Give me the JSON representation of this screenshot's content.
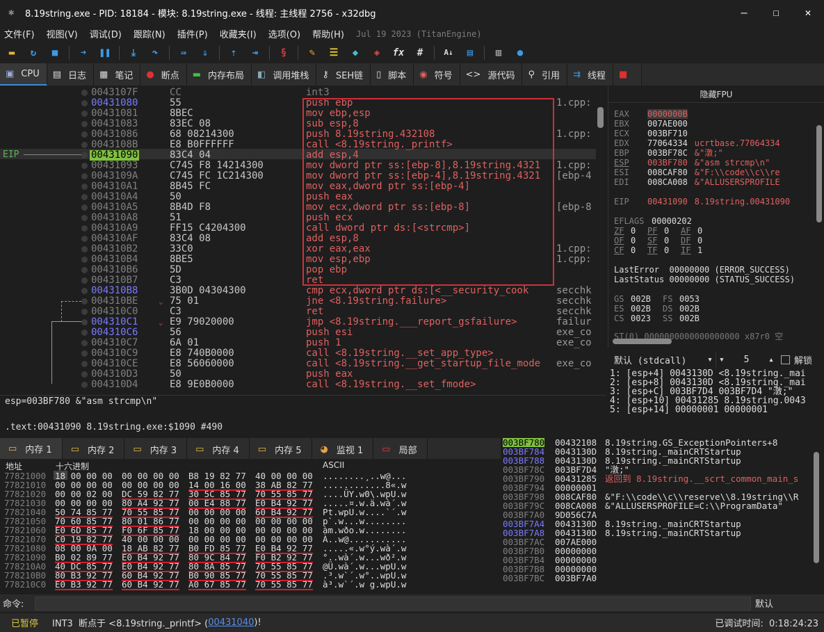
{
  "window": {
    "title": "8.19string.exe - PID: 18184 - 模块: 8.19string.exe - 线程: 主线程 2756 - x32dbg",
    "minimize": "—",
    "maximize": "☐",
    "close": "✕"
  },
  "menu": {
    "items": [
      "文件(F)",
      "视图(V)",
      "调试(D)",
      "跟踪(N)",
      "插件(P)",
      "收藏夹(I)",
      "选项(O)",
      "帮助(H)"
    ],
    "date": "Jul 19 2023 (TitanEngine)"
  },
  "toolbar": {
    "icons": [
      "open-icon",
      "restart-icon",
      "stop-icon",
      "run-icon",
      "pause-icon",
      "step-into-icon",
      "step-over-icon",
      "trace-into-icon",
      "trace-over-icon",
      "execute-till-return-icon",
      "run-to-user-code-icon",
      "scylla-icon",
      "patch-icon",
      "comment-icon",
      "label-icon",
      "bookmark-icon",
      "function-icon",
      "hash-icon",
      "font-icon",
      "calculator-icon",
      "memo-icon",
      "globe-icon"
    ]
  },
  "tabs_top": [
    {
      "label": "CPU",
      "icon": "cpu-icon"
    },
    {
      "label": "日志",
      "icon": "log-icon"
    },
    {
      "label": "笔记",
      "icon": "notes-icon"
    },
    {
      "label": "断点",
      "icon": "breakpoint-icon"
    },
    {
      "label": "内存布局",
      "icon": "memory-map-icon"
    },
    {
      "label": "调用堆栈",
      "icon": "callstack-icon"
    },
    {
      "label": "SEH链",
      "icon": "seh-icon"
    },
    {
      "label": "脚本",
      "icon": "script-icon"
    },
    {
      "label": "符号",
      "icon": "symbol-icon"
    },
    {
      "label": "源代码",
      "icon": "source-icon"
    },
    {
      "label": "引用",
      "icon": "reference-icon"
    },
    {
      "label": "线程",
      "icon": "thread-icon"
    }
  ],
  "disasm": {
    "eip_label": "EIP",
    "rows": [
      {
        "addr": "0043107F",
        "bytes": "CC",
        "asm": "int3",
        "cmt": "",
        "dim": true
      },
      {
        "addr": "00431080",
        "bytes": "55",
        "asm": "push ebp",
        "cmt": "1.cpp:"
      },
      {
        "addr": "00431081",
        "bytes": "8BEC",
        "asm": "mov ebp,esp",
        "cmt": ""
      },
      {
        "addr": "00431083",
        "bytes": "83EC 08",
        "asm": "sub esp,8",
        "cmt": ""
      },
      {
        "addr": "00431086",
        "bytes": "68 08214300",
        "asm": "push 8.19string.432108",
        "cmt": "1.cpp:"
      },
      {
        "addr": "0043108B",
        "bytes": "E8 B0FFFFFF",
        "asm": "call <8.19string._printf>",
        "cmt": ""
      },
      {
        "addr": "00431090",
        "bytes": "83C4 04",
        "asm": "add esp,4",
        "cmt": ""
      },
      {
        "addr": "00431093",
        "bytes": "C745 F8 14214300",
        "asm": "mov dword ptr ss:[ebp-8],8.19string.4321",
        "cmt": "1.cpp:"
      },
      {
        "addr": "0043109A",
        "bytes": "C745 FC 1C214300",
        "asm": "mov dword ptr ss:[ebp-4],8.19string.4321",
        "cmt": "[ebp-4"
      },
      {
        "addr": "004310A1",
        "bytes": "8B45 FC",
        "asm": "mov eax,dword ptr ss:[ebp-4]",
        "cmt": ""
      },
      {
        "addr": "004310A4",
        "bytes": "50",
        "asm": "push eax",
        "cmt": ""
      },
      {
        "addr": "004310A5",
        "bytes": "8B4D F8",
        "asm": "mov ecx,dword ptr ss:[ebp-8]",
        "cmt": "[ebp-8"
      },
      {
        "addr": "004310A8",
        "bytes": "51",
        "asm": "push ecx",
        "cmt": ""
      },
      {
        "addr": "004310A9",
        "bytes": "FF15 C4204300",
        "asm": "call dword ptr ds:[<strcmp>]",
        "cmt": ""
      },
      {
        "addr": "004310AF",
        "bytes": "83C4 08",
        "asm": "add esp,8",
        "cmt": ""
      },
      {
        "addr": "004310B2",
        "bytes": "33C0",
        "asm": "xor eax,eax",
        "cmt": "1.cpp:"
      },
      {
        "addr": "004310B4",
        "bytes": "8BE5",
        "asm": "mov esp,ebp",
        "cmt": "1.cpp:"
      },
      {
        "addr": "004310B6",
        "bytes": "5D",
        "asm": "pop ebp",
        "cmt": ""
      },
      {
        "addr": "004310B7",
        "bytes": "C3",
        "asm": "ret",
        "cmt": ""
      },
      {
        "addr": "004310B8",
        "bytes": "3B0D 04304300",
        "asm": "cmp ecx,dword ptr ds:[<__security_cook",
        "cmt": "secchk"
      },
      {
        "addr": "004310BE",
        "bytes": "75 01",
        "asm": "jne <8.19string.failure>",
        "cmt": "secchk"
      },
      {
        "addr": "004310C0",
        "bytes": "C3",
        "asm": "ret",
        "cmt": "secchk"
      },
      {
        "addr": "004310C1",
        "bytes": "E9 79020000",
        "asm": "jmp <8.19string.___report_gsfailure>",
        "cmt": "failur"
      },
      {
        "addr": "004310C6",
        "bytes": "56",
        "asm": "push esi",
        "cmt": "exe_co"
      },
      {
        "addr": "004310C7",
        "bytes": "6A 01",
        "asm": "push 1",
        "cmt": "exe_co"
      },
      {
        "addr": "004310C9",
        "bytes": "E8 740B0000",
        "asm": "call <8.19string.__set_app_type>",
        "cmt": ""
      },
      {
        "addr": "004310CE",
        "bytes": "E8 56060000",
        "asm": "call <8.19string.__get_startup_file_mode",
        "cmt": "exe_co"
      },
      {
        "addr": "004310D3",
        "bytes": "50",
        "asm": "push eax",
        "cmt": ""
      },
      {
        "addr": "004310D4",
        "bytes": "E8 9E0B0000",
        "asm": "call <8.19string.__set_fmode>",
        "cmt": ""
      }
    ]
  },
  "info_line1": "esp=003BF780 &\"asm strcmp\\n\"",
  "info_line2": ".text:00431090 8.19string.exe:$1090 #490",
  "registers": {
    "header": "隐藏FPU",
    "rows": [
      {
        "name": "EAX",
        "value": "0000000B",
        "sym": ""
      },
      {
        "name": "EBX",
        "value": "007AE000",
        "sym": ""
      },
      {
        "name": "ECX",
        "value": "003BF710",
        "sym": ""
      },
      {
        "name": "EDX",
        "value": "77064334",
        "sym": "ucrtbase.77064334"
      },
      {
        "name": "EBP",
        "value": "003BF78C",
        "sym": "&\"潡;\""
      },
      {
        "name": "ESP",
        "value": "003BF780",
        "sym": "&\"asm strcmp\\n\""
      },
      {
        "name": "ESI",
        "value": "008CAF80",
        "sym": "&\"F:\\\\code\\\\c\\\\re"
      },
      {
        "name": "EDI",
        "value": "008CA008",
        "sym": "&\"ALLUSERSPROFILE"
      },
      {
        "name": "EIP",
        "value": "00431090",
        "sym": "8.19string.00431090"
      }
    ],
    "eflags_label": "EFLAGS",
    "eflags_value": "00000202",
    "flags": [
      [
        {
          "n": "ZF",
          "v": "0"
        },
        {
          "n": "PF",
          "v": "0"
        },
        {
          "n": "AF",
          "v": "0"
        }
      ],
      [
        {
          "n": "OF",
          "v": "0"
        },
        {
          "n": "SF",
          "v": "0"
        },
        {
          "n": "DF",
          "v": "0"
        }
      ],
      [
        {
          "n": "CF",
          "v": "0"
        },
        {
          "n": "TF",
          "v": "0"
        },
        {
          "n": "IF",
          "v": "1"
        }
      ]
    ],
    "lasterror": "LastError  00000000 (ERROR_SUCCESS)",
    "laststatus": "LastStatus 00000000 (STATUS_SUCCESS)",
    "segs": [
      [
        {
          "n": "GS",
          "v": "002B"
        },
        {
          "n": "FS",
          "v": "0053"
        }
      ],
      [
        {
          "n": "ES",
          "v": "002B"
        },
        {
          "n": "DS",
          "v": "002B"
        }
      ],
      [
        {
          "n": "CS",
          "v": "0023"
        },
        {
          "n": "SS",
          "v": "002B"
        }
      ]
    ],
    "st0": "ST(0) 0000000000000000000 x87r0 空"
  },
  "callconv": {
    "selected": "默认 (stdcall)",
    "count": "5",
    "unlock_label": "解锁"
  },
  "args": [
    "1: [esp+4] 0043130D <8.19string._mai",
    "2: [esp+8] 0043130D <8.19string._mai",
    "3: [esp+C] 003BF7D4 003BF7D4 \"潡;\"",
    "4: [esp+10] 00431285 8.19string.0043",
    "5: [esp+14] 00000001 00000001"
  ],
  "tabs_bottom": [
    {
      "label": "内存 1",
      "icon": "memory-icon"
    },
    {
      "label": "内存 2",
      "icon": "memory-icon"
    },
    {
      "label": "内存 3",
      "icon": "memory-icon"
    },
    {
      "label": "内存 4",
      "icon": "memory-icon"
    },
    {
      "label": "内存 5",
      "icon": "memory-icon"
    },
    {
      "label": "监视 1",
      "icon": "watch-icon"
    },
    {
      "label": "局部",
      "icon": "locals-icon"
    }
  ],
  "dump": {
    "col_addr": "地址",
    "col_hex": "十六进制",
    "col_ascii": "ASCII",
    "rows": [
      {
        "addr": "77821000",
        "h": [
          "18 00 00 00",
          "00 00 00 00",
          "B8 19 82 77",
          "40 00 00 00"
        ],
        "a": "........¸..w@..."
      },
      {
        "addr": "77821010",
        "h": [
          "00 00 00 00",
          "00 00 00 00",
          "14 00 16 00",
          "38 AB 82 77"
        ],
        "a": "............8«.w"
      },
      {
        "addr": "77821020",
        "h": [
          "00 00 02 00",
          "DC 59 82 77",
          "30 5C 85 77",
          "70 55 85 77"
        ],
        "a": "....ÜY.w0\\.wpU.w"
      },
      {
        "addr": "77821030",
        "h": [
          "00 00 00 00",
          "80 A4 92 77",
          "00 E4 88 77",
          "E0 B4 92 77"
        ],
        "a": ".....¤.w.ä.wà´.w"
      },
      {
        "addr": "77821040",
        "h": [
          "50 74 85 77",
          "70 55 85 77",
          "00 00 00 00",
          "60 B4 92 77"
        ],
        "a": "Pt.wpU.w....`´.w"
      },
      {
        "addr": "77821050",
        "h": [
          "70 60 85 77",
          "80 01 86 77",
          "00 00 00 00",
          "00 00 00 00"
        ],
        "a": "p`.w...w........"
      },
      {
        "addr": "77821060",
        "h": [
          "E0 6D 85 77",
          "F0 6F 85 77",
          "18 00 00 00",
          "00 00 00 00"
        ],
        "a": "àm.wðo.w........"
      },
      {
        "addr": "77821070",
        "h": [
          "C0 19 82 77",
          "40 00 00 00",
          "00 00 00 00",
          "00 00 00 00"
        ],
        "a": "À..w@..........."
      },
      {
        "addr": "77821080",
        "h": [
          "08 00 0A 00",
          "18 AB 82 77",
          "B0 FD 85 77",
          "E0 B4 92 77"
        ],
        "a": ".....«.w°ý.wà´.w"
      },
      {
        "addr": "77821090",
        "h": [
          "B0 02 89 77",
          "E0 B4 92 77",
          "80 9C 84 77",
          "F0 B2 92 77"
        ],
        "a": "°..wà´.w...wð².w"
      },
      {
        "addr": "778210A0",
        "h": [
          "40 DC 85 77",
          "E0 B4 92 77",
          "80 8A 85 77",
          "70 55 85 77"
        ],
        "a": "@Ü.wà´.w...wpU.w"
      },
      {
        "addr": "778210B0",
        "h": [
          "80 B3 92 77",
          "60 B4 92 77",
          "B0 90 85 77",
          "70 55 85 77"
        ],
        "a": ".³.w`´.w°..wpU.w"
      },
      {
        "addr": "778210C0",
        "h": [
          "E0 B3 92 77",
          "60 B4 92 77",
          "A0 67 85 77",
          "70 55 85 77"
        ],
        "a": "à³.w`´.w g.wpU.w"
      }
    ]
  },
  "stack": {
    "rows": [
      {
        "a": "003BF780",
        "v": "00432108",
        "c": "8.19string.GS_ExceptionPointers+8"
      },
      {
        "a": "003BF784",
        "v": "0043130D",
        "c": "8.19string._mainCRTStartup"
      },
      {
        "a": "003BF788",
        "v": "0043130D",
        "c": "8.19string._mainCRTStartup"
      },
      {
        "a": "003BF78C",
        "v": "003BF7D4",
        "c": "\"潡;\""
      },
      {
        "a": "003BF790",
        "v": "00431285",
        "c": "返回到 8.19string.__scrt_common_main_s"
      },
      {
        "a": "003BF794",
        "v": "00000001",
        "c": ""
      },
      {
        "a": "003BF798",
        "v": "008CAF80",
        "c": "&\"F:\\\\code\\\\c\\\\reserve\\\\8.19string\\\\R"
      },
      {
        "a": "003BF79C",
        "v": "008CA008",
        "c": "&\"ALLUSERSPROFILE=C:\\\\ProgramData\""
      },
      {
        "a": "003BF7A0",
        "v": "9D056C7A",
        "c": ""
      },
      {
        "a": "003BF7A4",
        "v": "0043130D",
        "c": "8.19string._mainCRTStartup"
      },
      {
        "a": "003BF7A8",
        "v": "0043130D",
        "c": "8.19string._mainCRTStartup"
      },
      {
        "a": "003BF7AC",
        "v": "007AE000",
        "c": ""
      },
      {
        "a": "003BF7B0",
        "v": "00000000",
        "c": ""
      },
      {
        "a": "003BF7B4",
        "v": "00000000",
        "c": ""
      },
      {
        "a": "003BF7B8",
        "v": "00000000",
        "c": ""
      },
      {
        "a": "003BF7BC",
        "v": "003BF7A0",
        "c": ""
      }
    ]
  },
  "cmd": {
    "label": "命令:",
    "default": "默认"
  },
  "status": {
    "paused": "已暂停",
    "message": "INT3  断点于 <8.19string._printf> (",
    "link": "00431040",
    "message_end": ")!",
    "time": "已调试时间:  0:18:24:23"
  }
}
